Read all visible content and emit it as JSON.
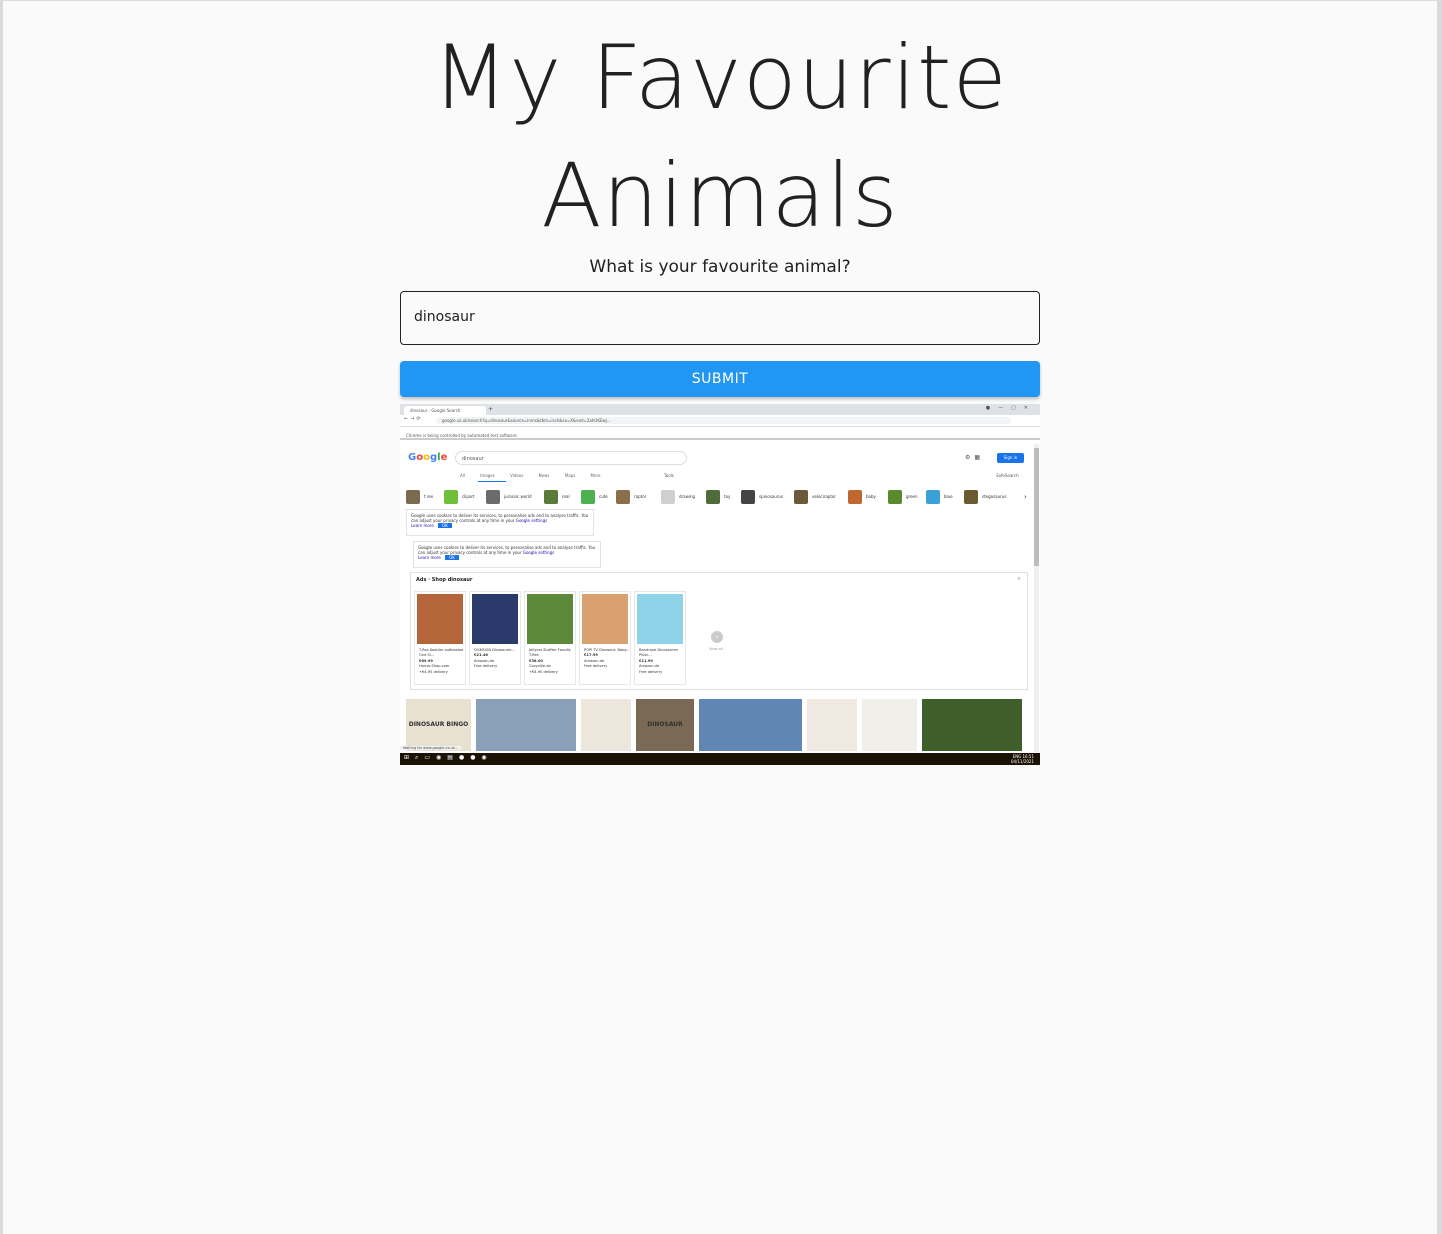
{
  "app": {
    "title_line1": "My Favourite",
    "title_line2": "Animals",
    "question": "What is your favourite animal?",
    "answer_value": "dinosaur",
    "submit_label": "SUBMIT"
  },
  "screenshot": {
    "tab_title": "dinosaur - Google Search",
    "url": "google.co.uk/search?q=dinosaur&source=lnms&tbm=isch&sa=X&ved=2ahUKEwj...",
    "infobar": "Chrome is being controlled by automated test software.",
    "logo_letters": [
      "G",
      "o",
      "o",
      "g",
      "l",
      "e"
    ],
    "search_query": "dinosaur",
    "sign_in": "Sign in",
    "tabs": "All Images Videos News Maps More",
    "tools": "Tools",
    "safesearch": "SafeSearch",
    "chips": [
      {
        "label": "t rex",
        "color": "#7a6a4f"
      },
      {
        "label": "clipart",
        "color": "#6fbf3a"
      },
      {
        "label": "jurassic world",
        "color": "#6b6b6b"
      },
      {
        "label": "real",
        "color": "#5a7a3a"
      },
      {
        "label": "cute",
        "color": "#4caf50"
      },
      {
        "label": "raptor",
        "color": "#8d6e4a"
      },
      {
        "label": "drawing",
        "color": "#cfcfcf"
      },
      {
        "label": "toy",
        "color": "#4f6b3a"
      },
      {
        "label": "spinosaurus",
        "color": "#444444"
      },
      {
        "label": "velociraptor",
        "color": "#6b5a3a"
      },
      {
        "label": "baby",
        "color": "#c0672e"
      },
      {
        "label": "green",
        "color": "#5b8a2e"
      },
      {
        "label": "blue",
        "color": "#3aa0d8"
      },
      {
        "label": "stegosaurus",
        "color": "#6a5a30"
      }
    ],
    "cookie_text": "Google uses cookies to deliver its services, to personalise ads and to analyse traffic. You can adjust your privacy controls at any time in your",
    "cookie_link": "Google settings",
    "cookie_learn": "Learn more",
    "cookie_ok": "OK",
    "shop_header": "Ads · Shop dinosaur",
    "shop_close": "×",
    "products": [
      {
        "name": "T-Rex Kostüm aufblasbar One Si...",
        "price": "€69.99",
        "store": "Horror-Shop.com",
        "ship": "+€4.95 delivery",
        "color": "#b5653a"
      },
      {
        "name": "OGMOGN Dinosaurie...",
        "price": "€21.46",
        "store": "Amazon.de",
        "ship": "Free delivery",
        "color": "#2a3a6a"
      },
      {
        "name": "Jellycat Stuffter Fossilly T-Rex",
        "price": "€38.00",
        "store": "Cozyville.de",
        "ship": "+€4.90 delivery",
        "color": "#5d8a3a"
      },
      {
        "name": "POPI TV Dinosaur: Baby...",
        "price": "€17.99",
        "store": "Amazon.de",
        "ship": "Free delivery",
        "color": "#d9a070"
      },
      {
        "name": "Bandrave Dinosaurier Plüsc...",
        "price": "€11.99",
        "store": "Amazon.de",
        "ship": "Free delivery",
        "color": "#8fd3e8"
      }
    ],
    "view_all": "View all",
    "images": [
      {
        "label": "DINOSAUR BINGO",
        "color": "#e9e1d0"
      },
      {
        "label": "",
        "color": "#8aa0b8"
      },
      {
        "label": "",
        "color": "#ece6dc"
      },
      {
        "label": "DINOSAUR",
        "color": "#7a6a55"
      },
      {
        "label": "",
        "color": "#5f86b5"
      },
      {
        "label": "",
        "color": "#efe9e2"
      },
      {
        "label": "",
        "color": "#f1efe9"
      },
      {
        "label": "",
        "color": "#3f5f2a"
      }
    ],
    "status_text": "Waiting for www.google.co.uk...",
    "clock_time": "16:51",
    "clock_date": "04/11/2021",
    "lang": "ENG"
  },
  "colors": {
    "accent": "#2196f3",
    "background": "#fafafa",
    "google_blue": "#1a73e8"
  }
}
